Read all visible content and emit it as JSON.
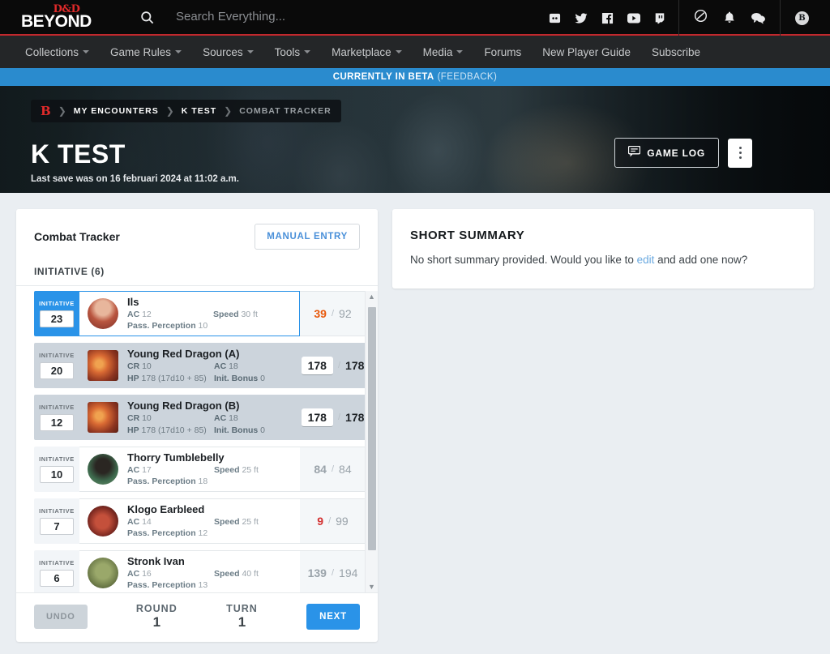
{
  "header": {
    "logo_top": "D&D",
    "logo_bottom": "BEYOND",
    "search_placeholder": "Search Everything...",
    "search_icon": "search-icon",
    "social": [
      {
        "name": "discord-icon",
        "label": "Discord"
      },
      {
        "name": "twitter-icon",
        "label": "Twitter"
      },
      {
        "name": "facebook-icon",
        "label": "Facebook"
      },
      {
        "name": "youtube-icon",
        "label": "YouTube"
      },
      {
        "name": "twitch-icon",
        "label": "Twitch"
      }
    ],
    "utilities": [
      {
        "name": "dice-icon",
        "label": "Dice Roller"
      },
      {
        "name": "bell-icon",
        "label": "Notifications"
      },
      {
        "name": "chat-icon",
        "label": "Messages"
      }
    ],
    "avatar_initial": "B"
  },
  "nav": {
    "items": [
      {
        "label": "Collections",
        "has_caret": true
      },
      {
        "label": "Game Rules",
        "has_caret": true
      },
      {
        "label": "Sources",
        "has_caret": true
      },
      {
        "label": "Tools",
        "has_caret": true
      },
      {
        "label": "Marketplace",
        "has_caret": true
      },
      {
        "label": "Media",
        "has_caret": true
      },
      {
        "label": "Forums",
        "has_caret": false
      },
      {
        "label": "New Player Guide",
        "has_caret": false
      },
      {
        "label": "Subscribe",
        "has_caret": false
      }
    ]
  },
  "beta_banner": {
    "text": "CURRENTLY IN BETA",
    "feedback": "(FEEDBACK)",
    "bg_color": "#2a8bce"
  },
  "hero": {
    "breadcrumb_logo": "B",
    "breadcrumb": [
      {
        "label": "MY ENCOUNTERS",
        "dim": false
      },
      {
        "label": "K TEST",
        "dim": false
      },
      {
        "label": "COMBAT TRACKER",
        "dim": true
      }
    ],
    "title": "K TEST",
    "subtitle": "Last save was on 16 februari 2024 at 11:02 a.m.",
    "game_log_label": "GAME LOG",
    "game_log_icon": "chat-bubble-icon",
    "kebab_icon": "more-options-icon"
  },
  "tracker": {
    "title": "Combat Tracker",
    "manual_entry_label": "MANUAL ENTRY",
    "initiative_header": "INITIATIVE (6)",
    "initiative_label": "INITIATIVE",
    "hp_separator": "/",
    "combatants": [
      {
        "name": "Ils",
        "initiative": "23",
        "active": true,
        "monster": false,
        "avatar_shape": "circle",
        "avatar_colors": [
          "#b9553f",
          "#e0a38a",
          "#7d2f28"
        ],
        "stat_left_label": "AC",
        "stat_left_value": "12",
        "stat_right_label": "Speed",
        "stat_right_value": "30 ft",
        "stat_wide_label": "Pass. Perception",
        "stat_wide_value": "10",
        "hp_current": "39",
        "hp_max": "92",
        "hp_color": "#e8590c",
        "hp_boxed": false
      },
      {
        "name": "Young Red Dragon (A)",
        "initiative": "20",
        "active": false,
        "monster": true,
        "avatar_shape": "square",
        "avatar_colors": [
          "#8e3520",
          "#d96a33",
          "#5a2014"
        ],
        "stat_left_label": "CR",
        "stat_left_value": "10",
        "stat_right_label": "AC",
        "stat_right_value": "18",
        "stat_wide_label": "HP",
        "stat_wide_value": "178 (17d10 + 85)",
        "stat_wide2_label": "Init. Bonus",
        "stat_wide2_value": "0",
        "hp_current": "178",
        "hp_max": "178",
        "hp_color": "#1c2024",
        "hp_boxed": true
      },
      {
        "name": "Young Red Dragon (B)",
        "initiative": "12",
        "active": false,
        "monster": true,
        "avatar_shape": "square",
        "avatar_colors": [
          "#8e3520",
          "#d96a33",
          "#5a2014"
        ],
        "stat_left_label": "CR",
        "stat_left_value": "10",
        "stat_right_label": "AC",
        "stat_right_value": "18",
        "stat_wide_label": "HP",
        "stat_wide_value": "178 (17d10 + 85)",
        "stat_wide2_label": "Init. Bonus",
        "stat_wide2_value": "0",
        "hp_current": "178",
        "hp_max": "178",
        "hp_color": "#1c2024",
        "hp_boxed": true
      },
      {
        "name": "Thorry Tumblebelly",
        "initiative": "10",
        "active": false,
        "monster": false,
        "avatar_shape": "circle",
        "avatar_colors": [
          "#3e6b4e",
          "#1d2b22",
          "#6f8f6a"
        ],
        "stat_left_label": "AC",
        "stat_left_value": "17",
        "stat_right_label": "Speed",
        "stat_right_value": "25 ft",
        "stat_wide_label": "Pass. Perception",
        "stat_wide_value": "18",
        "hp_current": "84",
        "hp_max": "84",
        "hp_color": "#9aa3aa",
        "hp_boxed": false
      },
      {
        "name": "Klogo Earbleed",
        "initiative": "7",
        "active": false,
        "monster": false,
        "avatar_shape": "circle",
        "avatar_colors": [
          "#7e2a22",
          "#c4503b",
          "#2b1413"
        ],
        "stat_left_label": "AC",
        "stat_left_value": "14",
        "stat_right_label": "Speed",
        "stat_right_value": "25 ft",
        "stat_wide_label": "Pass. Perception",
        "stat_wide_value": "12",
        "hp_current": "9",
        "hp_max": "99",
        "hp_color": "#d32f2f",
        "hp_boxed": false
      },
      {
        "name": "Stronk Ivan",
        "initiative": "6",
        "active": false,
        "monster": false,
        "avatar_shape": "circle",
        "avatar_colors": [
          "#6f7d4a",
          "#9aa86a",
          "#3c4426"
        ],
        "stat_left_label": "AC",
        "stat_left_value": "16",
        "stat_right_label": "Speed",
        "stat_right_value": "40 ft",
        "stat_wide_label": "Pass. Perception",
        "stat_wide_value": "13",
        "hp_current": "139",
        "hp_max": "194",
        "hp_color": "#9aa3aa",
        "hp_boxed": false
      }
    ],
    "footer": {
      "undo_label": "UNDO",
      "round_label": "ROUND",
      "round_value": "1",
      "turn_label": "TURN",
      "turn_value": "1",
      "next_label": "NEXT"
    }
  },
  "summary": {
    "title": "SHORT SUMMARY",
    "text_before": "No short summary provided. Would you like to ",
    "link": "edit",
    "text_after": " and add one now?"
  }
}
